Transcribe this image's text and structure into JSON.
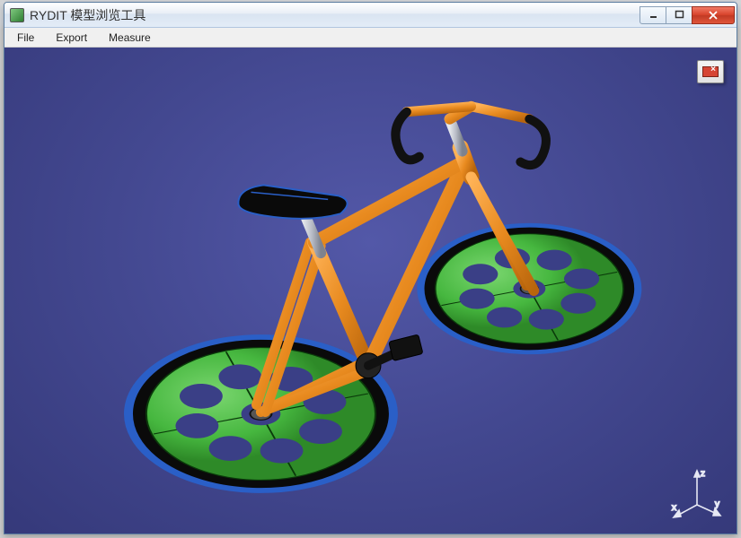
{
  "window": {
    "title": "RYDIT 模型浏览工具"
  },
  "menu": {
    "items": [
      "File",
      "Export",
      "Measure"
    ]
  },
  "viewport": {
    "background_color": "#444A90",
    "gizmo": {
      "axes": [
        "x",
        "y",
        "z"
      ]
    },
    "model": {
      "type": "bicycle",
      "colors": {
        "frame": "#e88a1f",
        "wheel_disc": "#46b73f",
        "tire": "#0a0a0a",
        "tire_edge": "#2a5fc7",
        "seat": "#0a0a0a",
        "seatpost": "#b8bcc6",
        "handlebar": "#1a1a1a",
        "pedal": "#1a1a1a"
      }
    }
  },
  "window_controls": {
    "minimize": "minimize",
    "maximize": "maximize",
    "close": "close"
  }
}
